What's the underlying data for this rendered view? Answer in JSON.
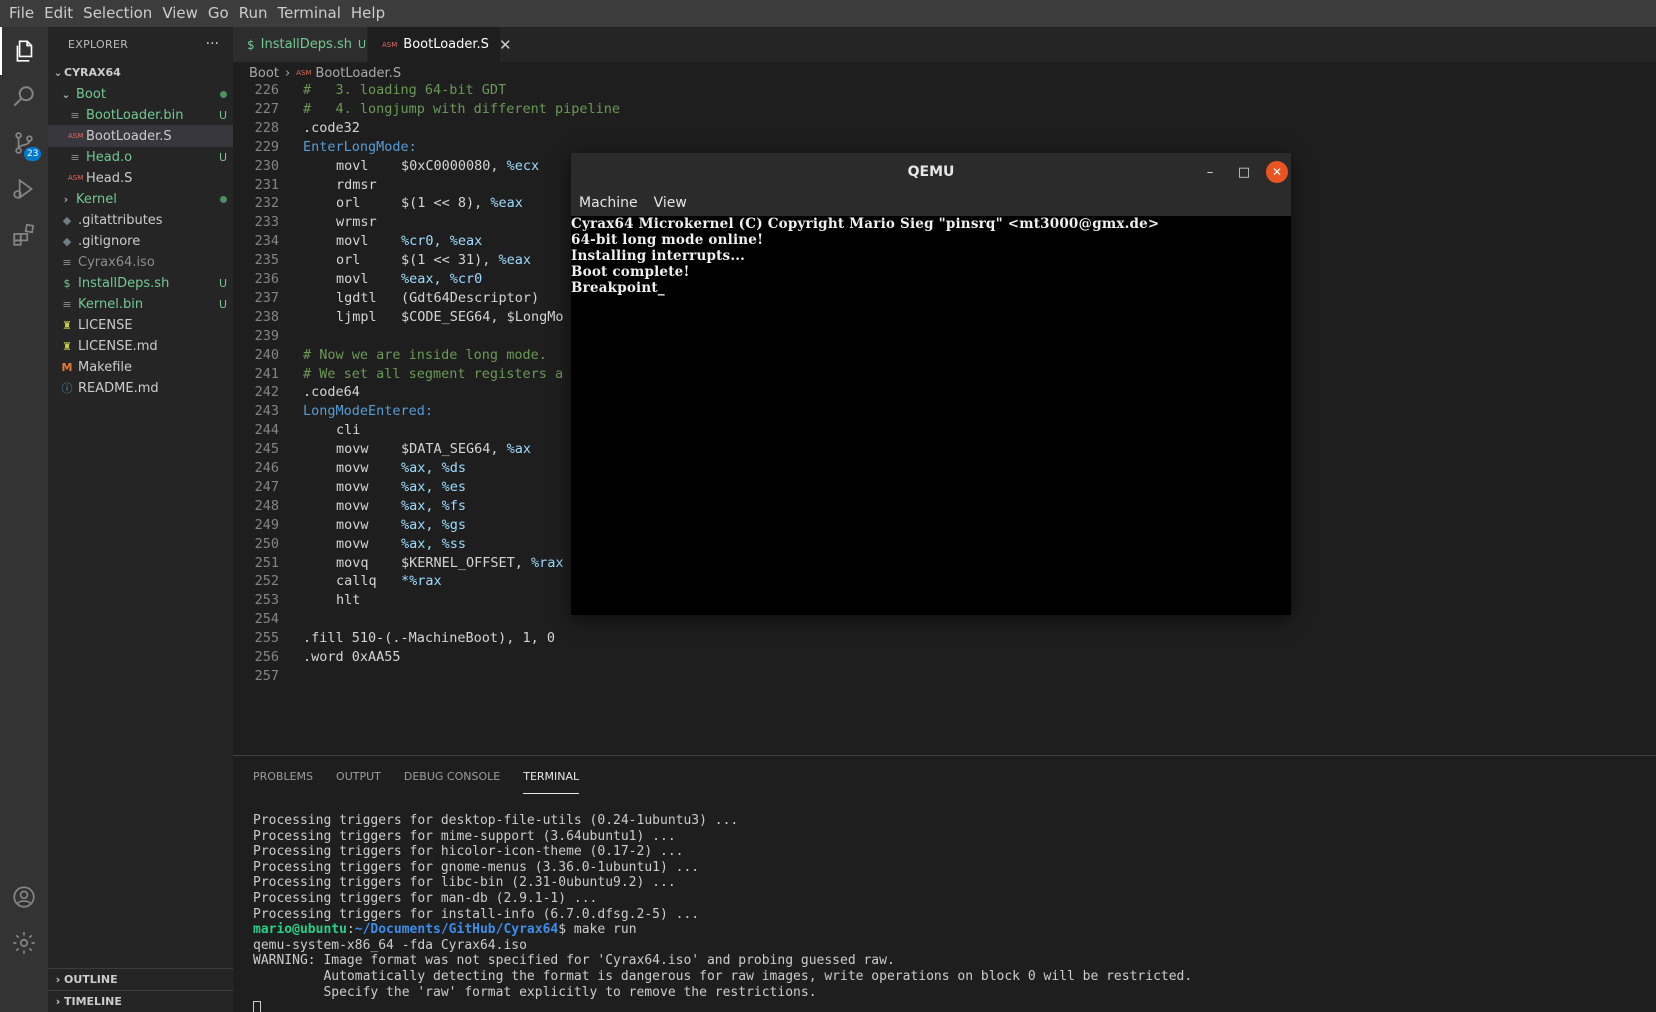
{
  "menubar": {
    "items": [
      "File",
      "Edit",
      "Selection",
      "View",
      "Go",
      "Run",
      "Terminal",
      "Help"
    ]
  },
  "activitybar": {
    "icons": [
      "explorer-icon",
      "search-icon",
      "source-control-icon",
      "run-debug-icon",
      "extensions-icon",
      "account-icon",
      "settings-gear-icon"
    ],
    "scm_badge": "23"
  },
  "sidebar": {
    "title": "EXPLORER",
    "more": "···",
    "root": "CYRAX64",
    "tree": [
      {
        "label": "Boot",
        "kind": "folder-open",
        "status": "dot"
      },
      {
        "label": "BootLoader.bin",
        "kind": "file",
        "icon": "≡",
        "status": "U"
      },
      {
        "label": "BootLoader.S",
        "kind": "file",
        "icon": "ASM",
        "status": ""
      },
      {
        "label": "Head.o",
        "kind": "file",
        "icon": "≡",
        "status": "U"
      },
      {
        "label": "Head.S",
        "kind": "file",
        "icon": "ASM",
        "status": ""
      },
      {
        "label": "Kernel",
        "kind": "folder",
        "status": "dot"
      },
      {
        "label": ".gitattributes",
        "kind": "file",
        "icon": "◆",
        "status": ""
      },
      {
        "label": ".gitignore",
        "kind": "file",
        "icon": "◆",
        "status": ""
      },
      {
        "label": "Cyrax64.iso",
        "kind": "file",
        "icon": "≡",
        "status": ""
      },
      {
        "label": "InstallDeps.sh",
        "kind": "file",
        "icon": "$",
        "status": "U"
      },
      {
        "label": "Kernel.bin",
        "kind": "file",
        "icon": "≡",
        "status": "U"
      },
      {
        "label": "LICENSE",
        "kind": "file",
        "icon": "♜",
        "status": ""
      },
      {
        "label": "LICENSE.md",
        "kind": "file",
        "icon": "♜",
        "status": ""
      },
      {
        "label": "Makefile",
        "kind": "file",
        "icon": "M",
        "status": ""
      },
      {
        "label": "README.md",
        "kind": "file",
        "icon": "ⓘ",
        "status": ""
      }
    ],
    "outline": "OUTLINE",
    "timeline": "TIMELINE"
  },
  "tabs": [
    {
      "label": "InstallDeps.sh",
      "icon": "$",
      "status": "U",
      "active": false
    },
    {
      "label": "BootLoader.S",
      "icon": "ASM",
      "status": "",
      "active": true,
      "close": "✕"
    }
  ],
  "breadcrumb": {
    "folder": "Boot",
    "sep": "›",
    "file": "BootLoader.S",
    "file_icon": "ASM"
  },
  "editor": {
    "lines": [
      {
        "n": "226",
        "text": "#   3. loading 64-bit GDT",
        "kind": "comment"
      },
      {
        "n": "227",
        "text": "#   4. longjump with different pipeline",
        "kind": "comment"
      },
      {
        "n": "228",
        "text": ".code32",
        "kind": "dir"
      },
      {
        "n": "229",
        "text": "EnterLongMode:",
        "kind": "label"
      },
      {
        "n": "230",
        "op": "movl",
        "a": "$0xC0000080, ",
        "b": "%ecx",
        "kind": "instr"
      },
      {
        "n": "231",
        "op": "rdmsr",
        "a": "",
        "b": "",
        "kind": "instr"
      },
      {
        "n": "232",
        "op": "orl",
        "a": "$(1 << 8), ",
        "b": "%eax",
        "kind": "instr"
      },
      {
        "n": "233",
        "op": "wrmsr",
        "a": "",
        "b": "",
        "kind": "instr"
      },
      {
        "n": "234",
        "op": "movl",
        "a": "",
        "b": "%cr0, %eax",
        "kind": "instr"
      },
      {
        "n": "235",
        "op": "orl",
        "a": "$(1 << 31), ",
        "b": "%eax",
        "kind": "instr"
      },
      {
        "n": "236",
        "op": "movl",
        "a": "",
        "b": "%eax, %cr0",
        "kind": "instr"
      },
      {
        "n": "237",
        "op": "lgdtl",
        "a": "(Gdt64Descriptor)",
        "b": "",
        "kind": "instr"
      },
      {
        "n": "238",
        "op": "ljmpl",
        "a": "$CODE_SEG64, $LongMo",
        "b": "",
        "kind": "instr"
      },
      {
        "n": "239",
        "text": "",
        "kind": "blank"
      },
      {
        "n": "240",
        "text": "# Now we are inside long mode.",
        "kind": "comment"
      },
      {
        "n": "241",
        "text": "# We set all segment registers a",
        "kind": "comment"
      },
      {
        "n": "242",
        "text": ".code64",
        "kind": "dir"
      },
      {
        "n": "243",
        "text": "LongModeEntered:",
        "kind": "label"
      },
      {
        "n": "244",
        "op": "cli",
        "a": "",
        "b": "",
        "kind": "instr"
      },
      {
        "n": "245",
        "op": "movw",
        "a": "$DATA_SEG64, ",
        "b": "%ax",
        "kind": "instr"
      },
      {
        "n": "246",
        "op": "movw",
        "a": "",
        "b": "%ax, %ds",
        "kind": "instr"
      },
      {
        "n": "247",
        "op": "movw",
        "a": "",
        "b": "%ax, %es",
        "kind": "instr"
      },
      {
        "n": "248",
        "op": "movw",
        "a": "",
        "b": "%ax, %fs",
        "kind": "instr"
      },
      {
        "n": "249",
        "op": "movw",
        "a": "",
        "b": "%ax, %gs",
        "kind": "instr"
      },
      {
        "n": "250",
        "op": "movw",
        "a": "",
        "b": "%ax, %ss",
        "kind": "instr"
      },
      {
        "n": "251",
        "op": "movq",
        "a": "$KERNEL_OFFSET, ",
        "b": "%rax",
        "kind": "instr"
      },
      {
        "n": "252",
        "op": "callq",
        "a": "",
        "b": "*%rax",
        "kind": "instr"
      },
      {
        "n": "253",
        "op": "hlt",
        "a": "",
        "b": "",
        "kind": "instr"
      },
      {
        "n": "254",
        "text": "",
        "kind": "blank"
      },
      {
        "n": "255",
        "text": ".fill 510-(.-MachineBoot), 1, 0",
        "kind": "dir"
      },
      {
        "n": "256",
        "text": ".word 0xAA55",
        "kind": "dir"
      },
      {
        "n": "257",
        "text": "",
        "kind": "blank"
      }
    ]
  },
  "panel": {
    "tabs": [
      "PROBLEMS",
      "OUTPUT",
      "DEBUG CONSOLE",
      "TERMINAL"
    ],
    "active_tab": "TERMINAL",
    "terminal_lines": [
      "Processing triggers for desktop-file-utils (0.24-1ubuntu3) ...",
      "Processing triggers for mime-support (3.64ubuntu1) ...",
      "Processing triggers for hicolor-icon-theme (0.17-2) ...",
      "Processing triggers for gnome-menus (3.36.0-1ubuntu1) ...",
      "Processing triggers for libc-bin (2.31-0ubuntu9.2) ...",
      "Processing triggers for man-db (2.9.1-1) ...",
      "Processing triggers for install-info (6.7.0.dfsg.2-5) ..."
    ],
    "prompt_user": "mario@ubuntu",
    "prompt_colon": ":",
    "prompt_path": "~/Documents/GitHub/Cyrax64",
    "prompt_cmd": "$ make run",
    "after_lines": [
      "qemu-system-x86_64 -fda Cyrax64.iso",
      "WARNING: Image format was not specified for 'Cyrax64.iso' and probing guessed raw.",
      "         Automatically detecting the format is dangerous for raw images, write operations on block 0 will be restricted.",
      "         Specify the 'raw' format explicitly to remove the restrictions."
    ]
  },
  "qemu": {
    "title": "QEMU",
    "minimize": "–",
    "maximize": "□",
    "close": "✕",
    "menu": [
      "Machine",
      "View"
    ],
    "screen_lines": [
      "Cyrax64 Microkernel (C) Copyright Mario Sieg \"pinsrq\" <mt3000@gmx.de>",
      "64-bit long mode online!",
      "Installing interrupts...",
      "Boot complete!",
      "Breakpoint_"
    ]
  },
  "colors": {
    "accent": "#007acc",
    "git_untracked": "#73c991",
    "qemu_close": "#e95420"
  }
}
